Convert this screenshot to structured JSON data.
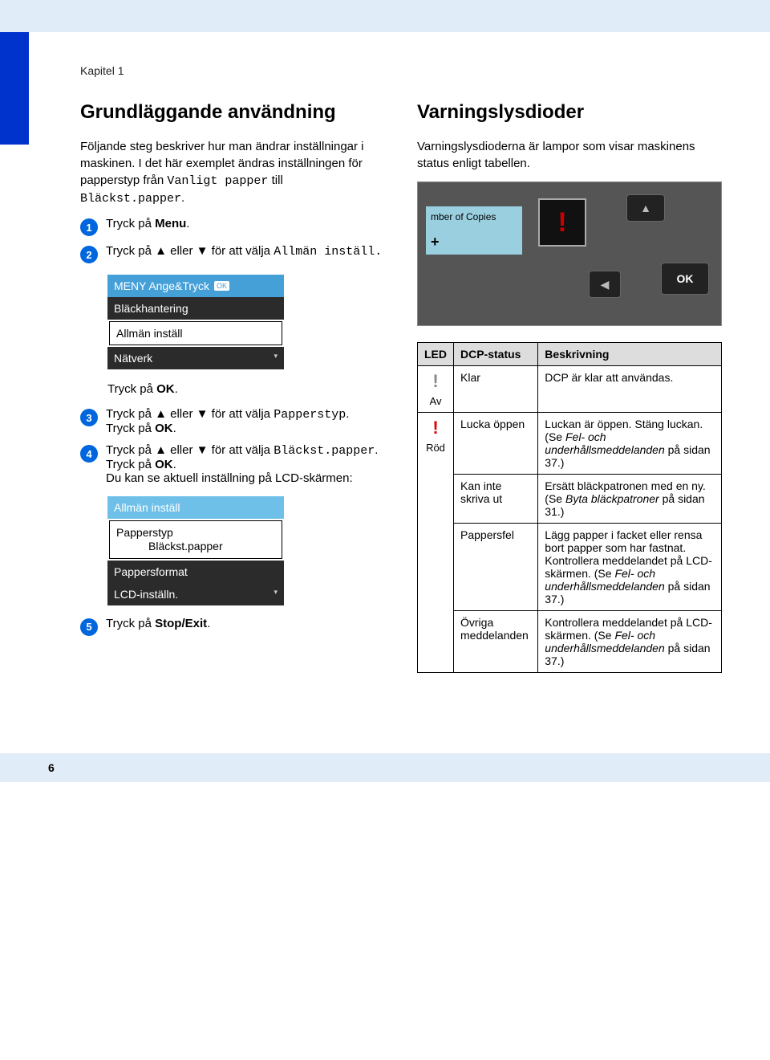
{
  "chapter": "Kapitel 1",
  "left": {
    "heading": "Grundläggande användning",
    "intro_a": "Följande steg beskriver hur man ändrar inställningar i maskinen. I det här exemplet ändras inställningen för papperstyp från ",
    "intro_mono1": "Vanligt papper",
    "intro_mid": " till ",
    "intro_mono2": "Bläckst.papper",
    "step1": "Tryck på ",
    "step1_bold": "Menu",
    "step2_a": "Tryck på ▲ eller ▼ för att välja ",
    "step2_mono": "Allmän inställ.",
    "lcd1": {
      "header": "MENY Ange&Tryck",
      "ok": "OK",
      "row1": "Bläckhantering",
      "sel": "Allmän inställ",
      "row2": "Nätverk"
    },
    "step2_ok": "Tryck på ",
    "step2_ok_bold": "OK",
    "step3_a": "Tryck på ▲ eller ▼ för att välja ",
    "step3_mono": "Papperstyp",
    "step3_ok": "Tryck på ",
    "step3_ok_bold": "OK",
    "step4_a": "Tryck på ▲ eller ▼ för att välja ",
    "step4_mono": "Bläckst.papper",
    "step4_ok": "Tryck på ",
    "step4_ok_bold": "OK",
    "step4_tail": "Du kan se aktuell inställning på LCD-skärmen:",
    "lcd2": {
      "header": "Allmän inställ",
      "sel_a": "Papperstyp",
      "sel_b": "Bläckst.papper",
      "row1": "Pappersformat",
      "row2": "LCD-inställn."
    },
    "step5": "Tryck på ",
    "step5_bold": "Stop/Exit"
  },
  "right": {
    "heading": "Varningslysdioder",
    "intro": "Varningslysdioderna är lampor som visar maskinens status enligt tabellen.",
    "panel": {
      "lcd_line": "mber of Copies",
      "plus": "+",
      "ok": "OK"
    },
    "table": {
      "h1": "LED",
      "h2": "DCP-status",
      "h3": "Beskrivning",
      "r1": {
        "led_label": "Av",
        "status": "Klar",
        "desc": "DCP är klar att användas."
      },
      "r2": {
        "led_label": "Röd",
        "a_status": "Lucka öppen",
        "a_desc": "Luckan är öppen. Stäng luckan. (Se ",
        "a_desc_i": "Fel- och underhållsmeddelanden",
        "a_desc2": " på sidan 37.)",
        "b_status": "Kan inte skriva ut",
        "b_desc": "Ersätt bläckpatronen med en ny. (Se ",
        "b_desc_i": "Byta bläckpatroner",
        "b_desc2": " på sidan 31.)",
        "c_status": "Pappersfel",
        "c_desc": "Lägg papper i facket eller rensa bort papper som har fastnat. Kontrollera meddelandet på LCD-skärmen. (Se ",
        "c_desc_i": "Fel- och underhållsmeddelanden",
        "c_desc2": " på sidan 37.)",
        "d_status": "Övriga meddelanden",
        "d_desc": "Kontrollera meddelandet på LCD-skärmen. (Se ",
        "d_desc_i": "Fel- och underhållsmeddelanden",
        "d_desc2": " på sidan 37.)"
      }
    }
  },
  "pagenum": "6"
}
